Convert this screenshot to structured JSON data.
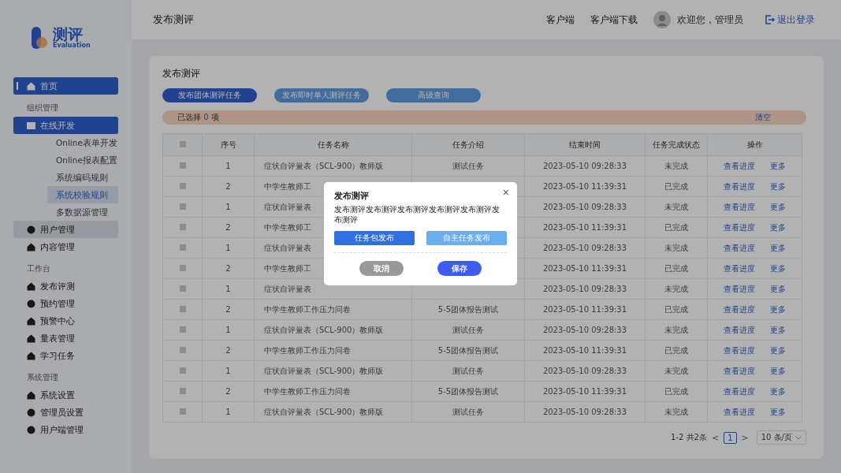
{
  "logo": {
    "name": "测评",
    "subtitle": "Evaluation"
  },
  "sidebar": {
    "sections": [
      {
        "items": [
          {
            "label": "首页",
            "selected": true
          }
        ]
      },
      {
        "heading": "组织管理",
        "items": [
          {
            "label": "在线开发",
            "selected": true,
            "children": [
              {
                "label": "Online表单开发",
                "selected": false
              },
              {
                "label": "Online报表配置",
                "selected": false
              },
              {
                "label": "系统编码规则",
                "selected": false
              },
              {
                "label": "系统校验规则",
                "selected": true
              },
              {
                "label": "多数据源管理",
                "selected": false
              }
            ]
          },
          {
            "label": "用户管理",
            "selected": false,
            "hovered": true
          },
          {
            "label": "内容管理",
            "selected": false
          }
        ]
      },
      {
        "heading": "工作台",
        "items": [
          {
            "label": "发布评测",
            "selected": false
          },
          {
            "label": "预约管理",
            "selected": false
          },
          {
            "label": "预警中心",
            "selected": false
          },
          {
            "label": "量表管理",
            "selected": false
          },
          {
            "label": "学习任务",
            "selected": false
          }
        ]
      },
      {
        "heading": "系统管理",
        "items": [
          {
            "label": "系统设置",
            "selected": false
          },
          {
            "label": "管理员设置",
            "selected": false
          },
          {
            "label": "用户端管理",
            "selected": false
          }
        ]
      }
    ]
  },
  "header": {
    "title": "发布测评",
    "links": [
      "客户端",
      "客户端下载"
    ],
    "welcome": "欢迎您，管理员",
    "logout": "退出登录"
  },
  "card": {
    "title": "发布测评",
    "tabs": [
      {
        "label": "发布团体测评任务",
        "selected": true
      },
      {
        "label": "发布即时单人测评任务",
        "selected": false
      },
      {
        "label": "高级查询",
        "selected": false
      }
    ],
    "selection": {
      "prefix": "已选择",
      "count": "0",
      "suffix": "项",
      "clear": "清空"
    },
    "table": {
      "all_checked": false,
      "columns": [
        "序号",
        "任务名称",
        "任务介绍",
        "结束时间",
        "任务完成状态",
        "操作"
      ],
      "rows": [
        {
          "checked": false,
          "index": "1",
          "name": "症状自评量表（SCL-900）教师版",
          "intro": "测试任务",
          "end": "2023-05-10 09:28:33",
          "status": "未完成",
          "actions": [
            "查看进度",
            "更多"
          ]
        },
        {
          "checked": false,
          "index": "2",
          "name": "中学生教师工",
          "end": "2023-05-10 11:39:31",
          "status": "已完成",
          "actions": [
            "查看进度",
            "更多"
          ]
        },
        {
          "checked": false,
          "index": "1",
          "name": "症状自评量表",
          "end": "2023-05-10 09:28:33",
          "status": "未完成",
          "actions": [
            "查看进度",
            "更多"
          ]
        },
        {
          "checked": false,
          "index": "2",
          "name": "中学生教师工",
          "end": "2023-05-10 11:39:31",
          "status": "已完成",
          "actions": [
            "查看进度",
            "更多"
          ]
        },
        {
          "checked": false,
          "index": "1",
          "name": "症状自评量表",
          "end": "2023-05-10 09:28:33",
          "status": "未完成",
          "actions": [
            "查看进度",
            "更多"
          ]
        },
        {
          "checked": false,
          "index": "2",
          "name": "中学生教师工",
          "end": "2023-05-10 11:39:31",
          "status": "已完成",
          "actions": [
            "查看进度",
            "更多"
          ]
        },
        {
          "checked": false,
          "index": "1",
          "name": "症状自评量表",
          "end": "2023-05-10 09:28:33",
          "status": "未完成",
          "actions": [
            "查看进度",
            "更多"
          ]
        },
        {
          "checked": false,
          "index": "2",
          "name": "中学生教师工作压力问卷",
          "intro": "5-5团体报告测试",
          "end": "2023-05-10 11:39:31",
          "status": "已完成",
          "actions": [
            "查看进度",
            "更多"
          ]
        },
        {
          "checked": false,
          "index": "1",
          "name": "症状自评量表（SCL-900）教师版",
          "intro": "测试任务",
          "end": "2023-05-10 09:28:33",
          "status": "未完成",
          "actions": [
            "查看进度",
            "更多"
          ]
        },
        {
          "checked": false,
          "index": "2",
          "name": "中学生教师工作压力问卷",
          "intro": "5-5团体报告测试",
          "end": "2023-05-10 11:39:31",
          "status": "已完成",
          "actions": [
            "查看进度",
            "更多"
          ]
        },
        {
          "checked": false,
          "index": "1",
          "name": "症状自评量表（SCL-900）教师版",
          "intro": "测试任务",
          "end": "2023-05-10 09:28:33",
          "status": "未完成",
          "actions": [
            "查看进度",
            "更多"
          ]
        },
        {
          "checked": false,
          "index": "2",
          "name": "中学生教师工作压力问卷",
          "intro": "5-5团体报告测试",
          "end": "2023-05-10 11:39:31",
          "status": "已完成",
          "actions": [
            "查看进度",
            "更多"
          ]
        },
        {
          "checked": false,
          "index": "1",
          "name": "症状自评量表（SCL-900）教师版",
          "intro": "测试任务",
          "end": "2023-05-10 09:28:33",
          "status": "未完成",
          "actions": [
            "查看进度",
            "更多"
          ]
        }
      ]
    },
    "pagination": {
      "summary": "1-2 共2条",
      "prev": "<",
      "pages": [
        {
          "label": "1",
          "selected": true
        }
      ],
      "next": ">",
      "page_size": "10 条/页"
    }
  },
  "dialog": {
    "title": "发布测评",
    "description": "发布测评发布测评发布测评发布测评发布测评发布测评",
    "options": [
      {
        "label": "任务包发布",
        "selected": true
      },
      {
        "label": "自主任务发布",
        "selected": false
      }
    ],
    "close": "×",
    "buttons": [
      {
        "label": "取消",
        "kind": "cancel"
      },
      {
        "label": "保存",
        "kind": "primary"
      }
    ]
  }
}
